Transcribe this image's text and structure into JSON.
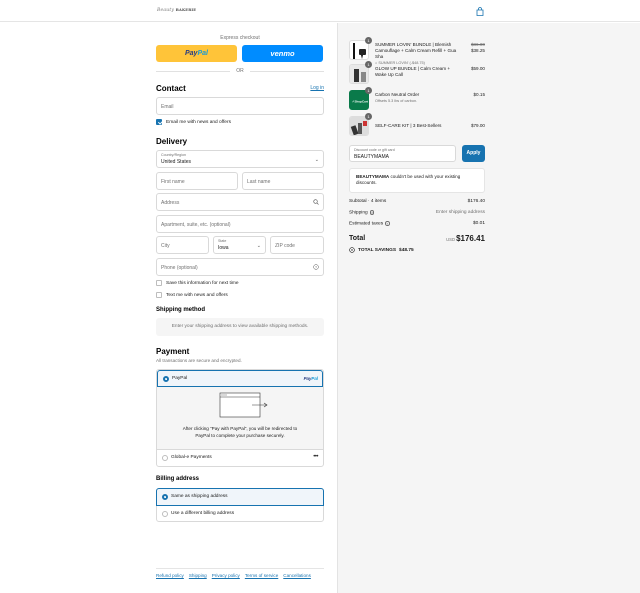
{
  "header": {
    "logo_script": "Beauty",
    "logo_brand": "BAKERIE",
    "cart_icon": "shopping-bag-icon"
  },
  "express": {
    "label": "Express checkout",
    "paypal_label_a": "Pay",
    "paypal_label_b": "Pal",
    "venmo_label": "venmo",
    "or_label": "OR"
  },
  "contact": {
    "heading": "Contact",
    "login_link": "Log in",
    "email_placeholder": "Email",
    "email_news_label": "Email me with news and offers",
    "email_news_checked": true
  },
  "delivery": {
    "heading": "Delivery",
    "country_label": "Country/Region",
    "country_value": "United States",
    "first_name": "First name",
    "last_name": "Last name",
    "address": "Address",
    "apartment": "Apartment, suite, etc. (optional)",
    "city": "City",
    "state_label": "State",
    "state_value": "Iowa",
    "zip": "ZIP code",
    "phone": "Phone (optional)",
    "save_info_label": "Save this information for next time",
    "text_news_label": "Text me with news and offers"
  },
  "shipping_method": {
    "heading": "Shipping method",
    "info": "Enter your shipping address to view available shipping methods."
  },
  "payment": {
    "heading": "Payment",
    "subtitle": "All transactions are secure and encrypted.",
    "paypal_option": "PayPal",
    "paypal_logo_a": "Pay",
    "paypal_logo_b": "Pal",
    "redirect_line1": "After clicking “Pay with PayPal”, you will be redirected to",
    "redirect_line2": "PayPal to complete your purchase securely.",
    "global_option": "Global-e Payments",
    "more_label": "•••"
  },
  "billing": {
    "heading": "Billing address",
    "same_label": "Same as shipping address",
    "different_label": "Use a different billing address"
  },
  "footer": {
    "links": [
      "Refund policy",
      "Shipping",
      "Privacy policy",
      "Terms of service",
      "Cancellations"
    ]
  },
  "order": {
    "items": [
      {
        "qty": "1",
        "name": "SUMMER LOVIN' BUNDLE | Blemish Camouflage + Calm Cream Refill + Gua Sha",
        "sub": "SUMMER LOVIN' (-$48.75)",
        "old_price": "$86.00",
        "price": "$38.25"
      },
      {
        "qty": "1",
        "name": "GLOW UP BUNDLE | Calm Cream + Wake Up Call",
        "sub": "",
        "old_price": "",
        "price": "$59.00"
      },
      {
        "qty": "1",
        "name": "Carbon Neutral Order",
        "sub": "Offsets 5.3 lbs of carbon.",
        "old_price": "",
        "price": "$0.15"
      },
      {
        "qty": "1",
        "name": "SELF-CARE KIT | 3 Best-Sellers",
        "sub": "",
        "old_price": "",
        "price": "$79.00"
      }
    ],
    "discount_label": "Discount code or gift card",
    "discount_value": "BEAUTYMAMA",
    "apply_label": "Apply",
    "error_code": "BEAUTYMAMA",
    "error_text": " couldn't be used with your existing discounts.",
    "subtotal_label": "Subtotal · 4 items",
    "subtotal_value": "$176.40",
    "shipping_label": "Shipping",
    "shipping_value": "Enter shipping address",
    "taxes_label": "Estimated taxes",
    "taxes_value": "$0.01",
    "total_label": "Total",
    "currency": "USD",
    "total_value": "$176.41",
    "savings_label": "TOTAL SAVINGS",
    "savings_value": "$48.75"
  },
  "colors": {
    "accent": "#1773b0",
    "paypal_yellow": "#ffc439",
    "venmo_blue": "#008cff",
    "sidebar_bg": "#f5f5f5"
  }
}
